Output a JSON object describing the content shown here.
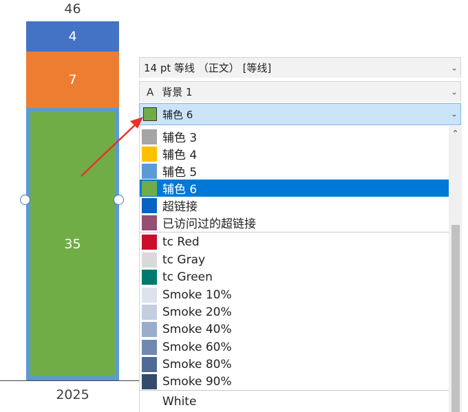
{
  "chart_data": {
    "type": "bar",
    "stacked": true,
    "categories": [
      "2025"
    ],
    "series": [
      {
        "values": [
          35
        ],
        "color": "#70AD47"
      },
      {
        "values": [
          7
        ],
        "color": "#ED7D31"
      },
      {
        "values": [
          4
        ],
        "color": "#4472C4"
      }
    ],
    "total_labels": [
      "46"
    ],
    "segment_labels": {
      "top": "4",
      "middle": "7",
      "bottom": "35"
    },
    "grid": false,
    "legend": "none"
  },
  "toolbar": {
    "font": "14 pt 等线 （正文） [等线]",
    "background_glyph": "A",
    "background": "背景 1",
    "selected_color_name": "辅色 6",
    "selected_color": "#70AD47"
  },
  "color_list": [
    {
      "label": "辅色 3",
      "color": "#A5A5A5"
    },
    {
      "label": "辅色 4",
      "color": "#FFC000"
    },
    {
      "label": "辅色 5",
      "color": "#5B9BD5"
    },
    {
      "label": "辅色 6",
      "color": "#70AD47",
      "selected": true
    },
    {
      "label": "超链接",
      "color": "#0563C1"
    },
    {
      "label": "已访问过的超链接",
      "color": "#954F72"
    },
    {
      "label": "tc Red",
      "color": "#C8102E"
    },
    {
      "label": "tc Gray",
      "color": "#D9D9D9"
    },
    {
      "label": "tc Green",
      "color": "#007A6E"
    },
    {
      "label": "Smoke 10%",
      "color": "#DCE3EC"
    },
    {
      "label": "Smoke 20%",
      "color": "#C3CFDF"
    },
    {
      "label": "Smoke 40%",
      "color": "#9AAECB"
    },
    {
      "label": "Smoke 60%",
      "color": "#7189B0"
    },
    {
      "label": "Smoke 80%",
      "color": "#4F6A96"
    },
    {
      "label": "Smoke 90%",
      "color": "#344B6B"
    },
    {
      "label": "White",
      "color": "#FFFFFF"
    }
  ],
  "icons": {
    "chevron": "chevron-down-icon",
    "scroll_up": "scroll-up-icon",
    "arrow": "arrow-annotation"
  },
  "annotation_color": "#E8312A"
}
